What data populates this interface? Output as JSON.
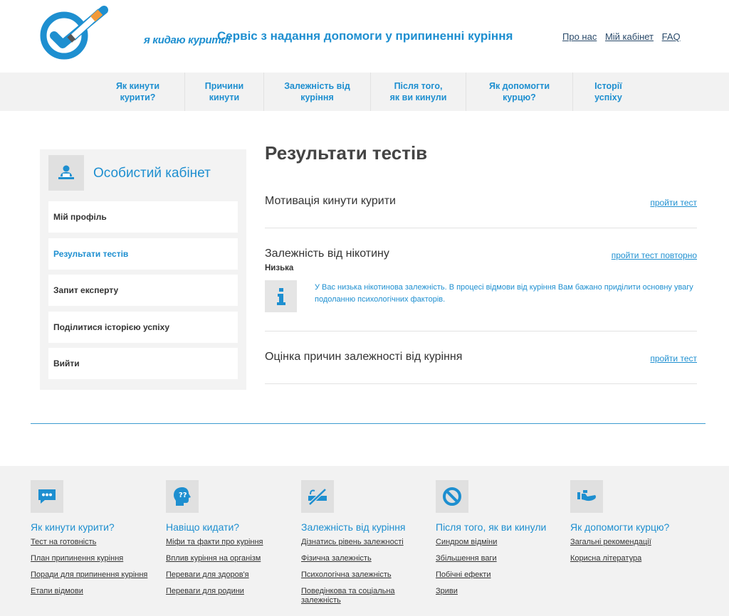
{
  "header": {
    "logo_text": "я кидаю курити!",
    "tagline": "Сервіс з надання допомоги у припиненні куріння",
    "links": [
      "Про нас",
      "Мій кабінет",
      "FAQ"
    ]
  },
  "nav": {
    "items": [
      {
        "line1": "Як кинути",
        "line2": "курити?"
      },
      {
        "line1": "Причини",
        "line2": "кинути"
      },
      {
        "line1": "Залежність від",
        "line2": "куріння"
      },
      {
        "line1": "Після того,",
        "line2": "як ви кинули"
      },
      {
        "line1": "Як допомогти",
        "line2": "курцю?"
      },
      {
        "line1": "Історії",
        "line2": "успіху"
      }
    ]
  },
  "sidebar": {
    "title": "Особистий кабінет",
    "items": [
      {
        "label": "Мій профіль"
      },
      {
        "label": "Результати тестів"
      },
      {
        "label": "Запит експерту"
      },
      {
        "label": "Поділитися історією успіху"
      },
      {
        "label": "Вийти"
      }
    ]
  },
  "main": {
    "title": "Результати тестів",
    "tests": [
      {
        "name": "Мотивація кинути курити",
        "link": "пройти тест"
      },
      {
        "name": "Залежність від нікотину",
        "link": "пройти тест повторно",
        "level": "Низька",
        "info": "У Вас низька нікотинова залежність. В процесі відмови від куріння Вам бажано приділити основну увагу подоланню психологічних факторів."
      },
      {
        "name": "Оцінка причин залежності від куріння",
        "link": "пройти тест"
      }
    ]
  },
  "footer": {
    "columns": [
      {
        "title": "Як кинути курити?",
        "links": [
          "Тест на готовність",
          "План припинення куріння",
          "Поради для припинення куріння",
          "Етапи відмови"
        ]
      },
      {
        "title": "Навіщо кидати?",
        "links": [
          "Міфи та факти про куріння",
          "Вплив куріння на організм",
          "Переваги для здоров'я",
          "Переваги для родини"
        ]
      },
      {
        "title": "Залежність від куріння",
        "links": [
          "Дізнатись рівень залежності",
          "Фізична залежність",
          "Психологічна залежність",
          "Поведінкова та соціальна залежність"
        ]
      },
      {
        "title": "Після того, як ви кинули",
        "links": [
          "Синдром відміни",
          "Збільшення ваги",
          "Побічні ефекти",
          "Зриви"
        ]
      },
      {
        "title": "Як допомогти курцю?",
        "links": [
          "Загальні рекомендації",
          "Корисна література"
        ]
      }
    ]
  },
  "colors": {
    "accent": "#1e8fd0",
    "panel": "#f2f2f2",
    "icon_bg": "#e0e0e0"
  }
}
